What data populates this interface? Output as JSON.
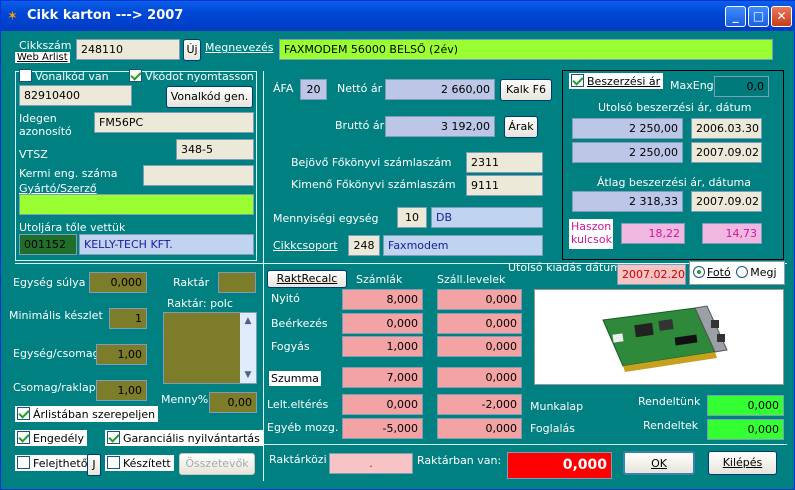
{
  "window": {
    "title": "Cikk karton ---> 2007"
  },
  "top": {
    "cikkszam_label": "Cikkszám",
    "weblista_label": "Web Árlist",
    "cikkszam": "248110",
    "uj_button": "Új",
    "megnevezes_label": "Megnevezés",
    "megnevezes": "FAXMODEM 56000 BELSŐ (2év)"
  },
  "left": {
    "vonalkod_van": "Vonalkód van",
    "vkodot_nyomtasson": "Vkódot nyomtasson",
    "vonalkod": "82910400",
    "vonalkod_gen": "Vonalkód gen.",
    "idegen_label1": "Idegen",
    "idegen_label2": "azonosító",
    "idegen": "FM56PC",
    "vtsz_label": "VTSZ",
    "vtsz": "348-5",
    "kermi_label": "Kermi eng. száma",
    "gyarto_label": "Gyártó/Szerző",
    "kermi": "",
    "gyarto": "",
    "utoljara_label": "Utoljára tőle vettük",
    "supplier_code": "001152",
    "supplier_name": "KELLY-TECH KFT."
  },
  "mid": {
    "afa_label": "ÁFA",
    "afa": "20",
    "netto_label": "Nettó ár",
    "netto": "2 660,00",
    "kalk_button": "Kalk F6",
    "brutto_label": "Bruttó ár",
    "brutto": "3 192,00",
    "arak_button": "Árak",
    "bejovo_label": "Bejövő Főkönyvi számlaszám",
    "bejovo": "2311",
    "kimeno_label": "Kimenő Főkönyvi számlaszám",
    "kimeno": "9111",
    "menny_label": "Mennyiségi egység",
    "menny_code": "10",
    "menny_name": "DB",
    "csoport_label": "Cikkcsoport",
    "csoport_code": "248",
    "csoport_name": "Faxmodem"
  },
  "right": {
    "beszerzesi_ar": "Beszerzési ár",
    "maxeng_label": "MaxEng",
    "maxeng": "0,0",
    "utolso_label": "Utolsó beszerzési ár, dátum",
    "ar1": "2 250,00",
    "datum1": "2006.03.30",
    "ar2": "2 250,00",
    "datum2": "2007.09.02",
    "atlag_label": "Átlag beszerzési ár, dátuma",
    "atlag": "2 318,33",
    "atlag_datum": "2007.09.02",
    "haszon_label1": "Haszon",
    "haszon_label2": "kulcsok",
    "haszon1": "18,22",
    "haszon2": "14,73"
  },
  "stock": {
    "egyseg_sulya_label": "Egység súlya",
    "egyseg_sulya": "0,000",
    "raktar_label": "Raktár",
    "raktar": "",
    "min_keszlet_label": "Minimális készlet",
    "min_keszlet": "1",
    "raktar_polc_label": "Raktár: polc",
    "egyseg_csomag_label": "Egység/csomag",
    "egyseg_csomag": "1,00",
    "csomag_raklap_label": "Csomag/raklap",
    "csomag_raklap": "1,00",
    "menny_pct_label": "Menny%",
    "menny_pct": "0,00",
    "arlistaban": "Árlistában szerepeljen",
    "engedely": "Engedély",
    "garancialis": "Garanciális nyilvántartás",
    "felejtheto": "Felejthető",
    "j_label": "J",
    "keszitett": "Készített",
    "osszetevok": "Összetevők"
  },
  "table": {
    "raktrecalc_button": "RaktRecalc",
    "col_szamlak": "Számlák",
    "col_szall": "Száll.levelek",
    "rows": [
      {
        "label": "Nyitó",
        "szamlak": "8,000",
        "szall": "0,000"
      },
      {
        "label": "Beérkezés",
        "szamlak": "0,000",
        "szall": "0,000"
      },
      {
        "label": "Fogyás",
        "szamlak": "1,000",
        "szall": "0,000"
      }
    ],
    "szumma_label": "Szumma",
    "szumma_szamlak": "7,000",
    "szumma_szall": "0,000",
    "lelt_label": "Lelt.eltérés",
    "lelt_szamlak": "0,000",
    "lelt_szall": "-2,000",
    "egyeb_label": "Egyéb mozg.",
    "egyeb_szamlak": "-5,000",
    "egyeb_szall": "0,000"
  },
  "photo": {
    "utolso_kiadas_label": "Utolsó kiadás dátuma",
    "utolso_kiadas": "2007.02.20",
    "foto": "Fotó",
    "megj": "Megj"
  },
  "orders": {
    "munkalap_label": "Munkalap",
    "foglalas_label": "Foglalás",
    "rendeltunk_label": "Rendeltünk",
    "rendeltunk": "0,000",
    "rendeltek_label": "Rendeltek",
    "rendeltek": "0,000"
  },
  "bottom": {
    "raktarkozi_label": "Raktárközi",
    "raktarkozi": ".",
    "raktarban_van_label": "Raktárban van:",
    "raktarban_van": "0,000",
    "ok_button": "OK",
    "kilepes_button": "Kilépés"
  },
  "colors": {
    "background": "#008080",
    "titlebar": "#0054e3",
    "accent_green": "#99ff33",
    "stock_red": "#ff0000"
  }
}
